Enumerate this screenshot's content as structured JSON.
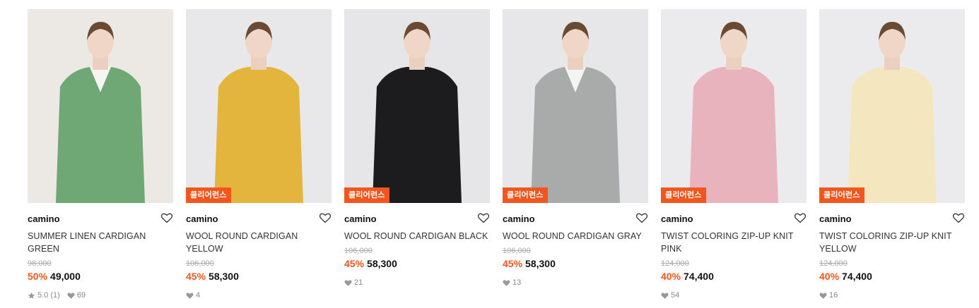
{
  "products": [
    {
      "brand": "camino",
      "name": "SUMMER LINEN CARDIGAN GREEN",
      "original_price": "98,000",
      "discount": "50%",
      "price": "49,000",
      "badge": "",
      "rating": "5.0",
      "review_count": "(1)",
      "likes": "69",
      "garment_color": "#6fa874",
      "bg_color": "#ece9e4",
      "inner_color": "#f7f5f1",
      "bottom_color": "#f3f1ed"
    },
    {
      "brand": "camino",
      "name": "WOOL ROUND CARDIGAN YELLOW",
      "original_price": "106,000",
      "discount": "45%",
      "price": "58,300",
      "badge": "클리어런스",
      "likes": "4",
      "garment_color": "#e3b53c",
      "bg_color": "#e8e8ea",
      "inner_color": "#e3b53c",
      "bottom_color": "#f2f0ec"
    },
    {
      "brand": "camino",
      "name": "WOOL ROUND CARDIGAN BLACK",
      "original_price": "106,000",
      "discount": "45%",
      "price": "58,300",
      "badge": "클리어런스",
      "likes": "21",
      "garment_color": "#1c1c1e",
      "bg_color": "#e6e6e9",
      "inner_color": "#1c1c1e",
      "bottom_color": "#5a4436"
    },
    {
      "brand": "camino",
      "name": "WOOL ROUND CARDIGAN GRAY",
      "original_price": "106,000",
      "discount": "45%",
      "price": "58,300",
      "badge": "클리어런스",
      "likes": "13",
      "garment_color": "#a9abaa",
      "bg_color": "#e7e7ea",
      "inner_color": "#f4f4f2",
      "bottom_color": "#6b5a4a"
    },
    {
      "brand": "camino",
      "name": "TWIST COLORING ZIP-UP KNIT PINK",
      "original_price": "124,000",
      "discount": "40%",
      "price": "74,400",
      "badge": "클리어런스",
      "likes": "54",
      "garment_color": "#e9b3bd",
      "bg_color": "#ebebed",
      "inner_color": "#e9b3bd",
      "bottom_color": "#f3f0ea"
    },
    {
      "brand": "camino",
      "name": "TWIST COLORING ZIP-UP KNIT YELLOW",
      "original_price": "124,000",
      "discount": "40%",
      "price": "74,400",
      "badge": "클리어런스",
      "likes": "16",
      "garment_color": "#f4e7bf",
      "bg_color": "#ebebed",
      "inner_color": "#f4e7bf",
      "bottom_color": "#1e1e20"
    }
  ],
  "icons": {
    "wishlist": "heart-outline-icon",
    "like": "heart-filled-icon",
    "rating": "star-icon"
  },
  "colors": {
    "accent": "#f2561d",
    "meta_gray": "#888888"
  }
}
